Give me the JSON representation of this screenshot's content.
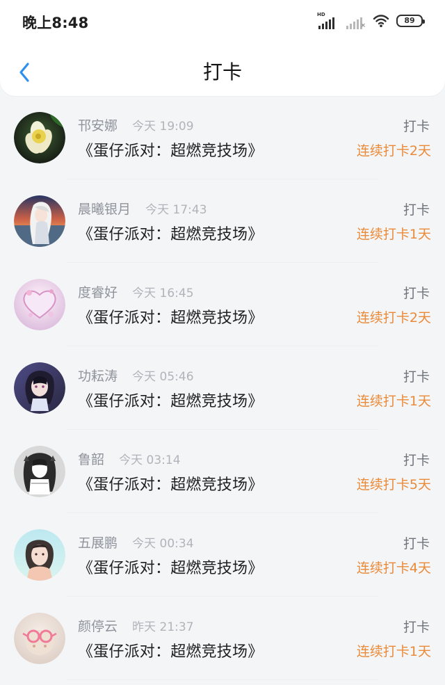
{
  "status_bar": {
    "time": "晚上8:48",
    "signal_label": "HD",
    "battery": "89"
  },
  "header": {
    "title": "打卡"
  },
  "items": [
    {
      "username": "邗安娜",
      "time": "今天 19:09",
      "game": "《蛋仔派对：超燃竞技场》",
      "action": "打卡",
      "streak": "连续打卡2天",
      "avatar_icon": "flower-avatar-icon"
    },
    {
      "username": "晨曦银月",
      "time": "今天 17:43",
      "game": "《蛋仔派对：超燃竞技场》",
      "action": "打卡",
      "streak": "连续打卡1天",
      "avatar_icon": "sunset-girl-avatar-icon"
    },
    {
      "username": "度睿好",
      "time": "今天 16:45",
      "game": "《蛋仔派对：超燃竞技场》",
      "action": "打卡",
      "streak": "连续打卡2天",
      "avatar_icon": "pink-heart-avatar-icon"
    },
    {
      "username": "功耘涛",
      "time": "今天 05:46",
      "game": "《蛋仔派对：超燃竞技场》",
      "action": "打卡",
      "streak": "连续打卡1天",
      "avatar_icon": "anime-girl-avatar-icon"
    },
    {
      "username": "鲁韶",
      "time": "今天 03:14",
      "game": "《蛋仔派对：超燃竞技场》",
      "action": "打卡",
      "streak": "连续打卡5天",
      "avatar_icon": "monochrome-anime-avatar-icon"
    },
    {
      "username": "五展鹏",
      "time": "今天 00:34",
      "game": "《蛋仔派对：超燃竞技场》",
      "action": "打卡",
      "streak": "连续打卡4天",
      "avatar_icon": "portrait-girl-avatar-icon"
    },
    {
      "username": "颜停云",
      "time": "昨天 21:37",
      "game": "《蛋仔派对：超燃竞技场》",
      "action": "打卡",
      "streak": "连续打卡1天",
      "avatar_icon": "pink-glasses-avatar-icon"
    }
  ],
  "colors": {
    "accent_blue": "#2f8ff0",
    "streak_orange": "#ea8a39",
    "muted_text": "#8f949c",
    "background": "#f4f5f7"
  }
}
